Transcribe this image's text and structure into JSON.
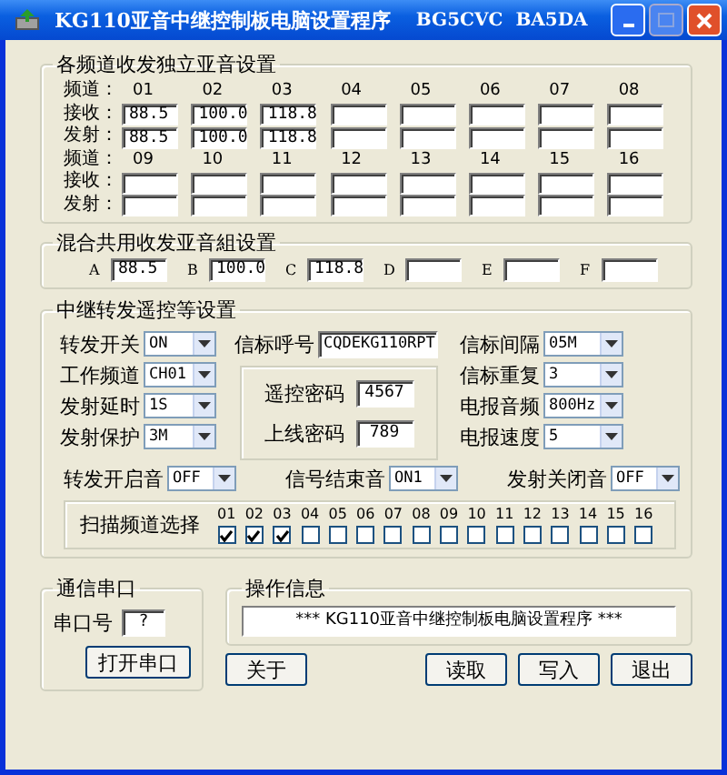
{
  "window": {
    "title": "KG110亚音中继控制板电脑设置程序",
    "subtitle": "BG5CVC  BA5DA"
  },
  "independent": {
    "title": "各频道收发独立亚音设置",
    "rows": [
      {
        "channel_label": "频道：",
        "rx_label": "接收：",
        "tx_label": "发射：",
        "channels": [
          {
            "number": "01",
            "rx": "88.5",
            "tx": "88.5"
          },
          {
            "number": "02",
            "rx": "100.0",
            "tx": "100.0"
          },
          {
            "number": "03",
            "rx": "118.8",
            "tx": "118.8"
          },
          {
            "number": "04"
          },
          {
            "number": "05"
          },
          {
            "number": "06"
          },
          {
            "number": "07"
          },
          {
            "number": "08"
          }
        ]
      },
      {
        "channel_label": "频道：",
        "rx_label": "接收：",
        "tx_label": "发射：",
        "channels": [
          {
            "number": "09"
          },
          {
            "number": "10"
          },
          {
            "number": "11"
          },
          {
            "number": "12"
          },
          {
            "number": "13"
          },
          {
            "number": "14"
          },
          {
            "number": "15"
          },
          {
            "number": "16"
          }
        ]
      }
    ]
  },
  "mixed": {
    "title": "混合共用收发亚音組设置",
    "groups": [
      {
        "letter": "A",
        "value": "88.5"
      },
      {
        "letter": "B",
        "value": "100.0"
      },
      {
        "letter": "C",
        "value": "118.8"
      },
      {
        "letter": "D"
      },
      {
        "letter": "E"
      },
      {
        "letter": "F"
      }
    ]
  },
  "relay": {
    "title": "中继转发遥控等设置",
    "left": [
      {
        "label": "转发开关",
        "value": "ON"
      },
      {
        "label": "工作频道",
        "value": "CH01"
      },
      {
        "label": "发射延时",
        "value": "1S"
      },
      {
        "label": "发射保护",
        "value": "3M"
      }
    ],
    "beacon_call": {
      "label": "信标呼号",
      "value": "CQDEKG110RPT"
    },
    "passwords": [
      {
        "label": "遥控密码",
        "value": "4567"
      },
      {
        "label": "上线密码",
        "value": "789"
      }
    ],
    "right": [
      {
        "label": "信标间隔",
        "value": "05M"
      },
      {
        "label": "信标重复",
        "value": "3"
      },
      {
        "label": "电报音频",
        "value": "800Hz"
      },
      {
        "label": "电报速度",
        "value": "5"
      }
    ],
    "tones": [
      {
        "label": "转发开启音",
        "value": "OFF"
      },
      {
        "label": "信号结束音",
        "value": "ON1"
      },
      {
        "label": "发射关闭音",
        "value": "OFF"
      }
    ],
    "scan": {
      "label": "扫描频道选择",
      "channels": [
        {
          "number": "01",
          "checked": true
        },
        {
          "number": "02",
          "checked": true
        },
        {
          "number": "03",
          "checked": true
        },
        {
          "number": "04",
          "checked": false
        },
        {
          "number": "05",
          "checked": false
        },
        {
          "number": "06",
          "checked": false
        },
        {
          "number": "07",
          "checked": false
        },
        {
          "number": "08",
          "checked": false
        },
        {
          "number": "09",
          "checked": false
        },
        {
          "number": "10",
          "checked": false
        },
        {
          "number": "11",
          "checked": false
        },
        {
          "number": "12",
          "checked": false
        },
        {
          "number": "13",
          "checked": false
        },
        {
          "number": "14",
          "checked": false
        },
        {
          "number": "15",
          "checked": false
        },
        {
          "number": "16",
          "checked": false
        }
      ]
    }
  },
  "serial": {
    "title": "通信串口",
    "port_label": "串口号",
    "port_value": "?",
    "open_button": "打开串口"
  },
  "info": {
    "title": "操作信息",
    "message": "*** KG110亚音中继控制板电脑设置程序 ***"
  },
  "buttons": [
    {
      "label": "关于"
    },
    {
      "label": "读取"
    },
    {
      "label": "写入"
    },
    {
      "label": "退出"
    }
  ]
}
